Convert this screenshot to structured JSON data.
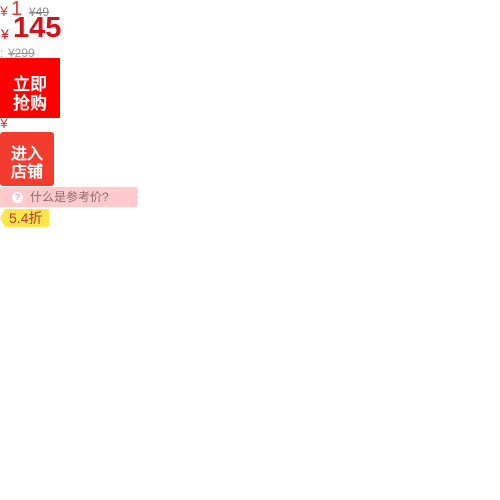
{
  "colors": {
    "price_red": "#d0141c",
    "buy_button_red": "#ff0000",
    "store_button_red": "#f23c2f",
    "ref_bar_pink": "#ffcacc",
    "discount_yellow": "#ffe54d"
  },
  "price": {
    "currency_symbol": "¥",
    "small_value": "1",
    "original_price_1": "¥49",
    "main_value": "145",
    "prefix": ":",
    "original_price_2": "¥299"
  },
  "buttons": {
    "buy_now": {
      "line1": "立即",
      "line2": "抢购"
    },
    "enter_store": {
      "line1": "进入",
      "line2": "店铺"
    }
  },
  "reference_price": {
    "icon": "question-icon",
    "text": "什么是参考价?"
  },
  "discount": {
    "label": "5.4折"
  }
}
